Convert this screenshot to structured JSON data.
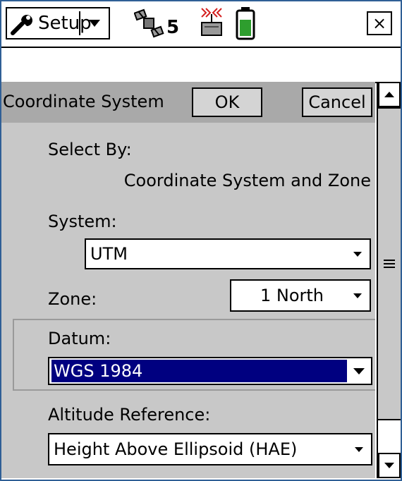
{
  "titlebar": {
    "menu_label": "Setup",
    "satellite_count": "5",
    "close_glyph": "×",
    "icons": [
      "wrench-icon",
      "satellite-icon",
      "gps-receiver-icon",
      "battery-icon"
    ],
    "battery_color": "#2e9e2e"
  },
  "dialog": {
    "title": "Coordinate System",
    "ok_label": "OK",
    "cancel_label": "Cancel",
    "select_by_label": "Select By:",
    "select_by_value": "Coordinate System and Zone",
    "system_label": "System:",
    "system_value": "UTM",
    "zone_label": "Zone:",
    "zone_value": "1 North",
    "datum_label": "Datum:",
    "datum_value": "WGS 1984",
    "altitude_label": "Altitude Reference:",
    "altitude_value": "Height Above Ellipsoid (HAE)"
  },
  "colors": {
    "header_gray": "#a9a9a9",
    "panel_gray": "#c8c8c8",
    "selection": "#000080",
    "frame_border": "#2f5f96"
  }
}
